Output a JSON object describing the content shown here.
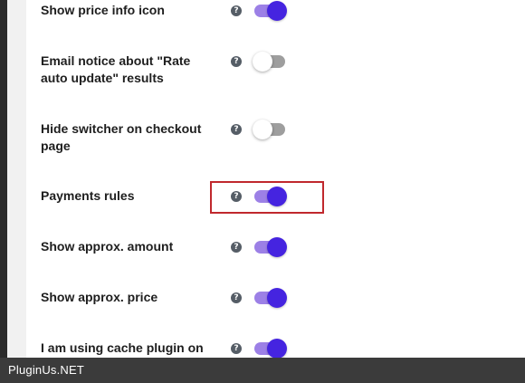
{
  "settings": {
    "rows": [
      {
        "label": "Show price info icon",
        "enabled": true
      },
      {
        "label": "Email notice about \"Rate auto update\" results",
        "enabled": false
      },
      {
        "label": "Hide switcher on checkout page",
        "enabled": false
      },
      {
        "label": "Payments rules",
        "enabled": true,
        "highlighted": true
      },
      {
        "label": "Show approx. amount",
        "enabled": true
      },
      {
        "label": "Show approx. price",
        "enabled": true
      },
      {
        "label": "I am using cache plugin on",
        "enabled": true
      }
    ],
    "help_glyph": "?"
  },
  "colors": {
    "toggle_on_track": "#9c80e6",
    "toggle_on_knob": "#4524e0",
    "toggle_off_track": "#9e9e9e",
    "highlight_border": "#c0282d",
    "footer_bg": "#3b3b3b"
  },
  "icons": {
    "help": "question-circle-icon"
  },
  "footer": {
    "brand": "PluginUs.NET"
  }
}
